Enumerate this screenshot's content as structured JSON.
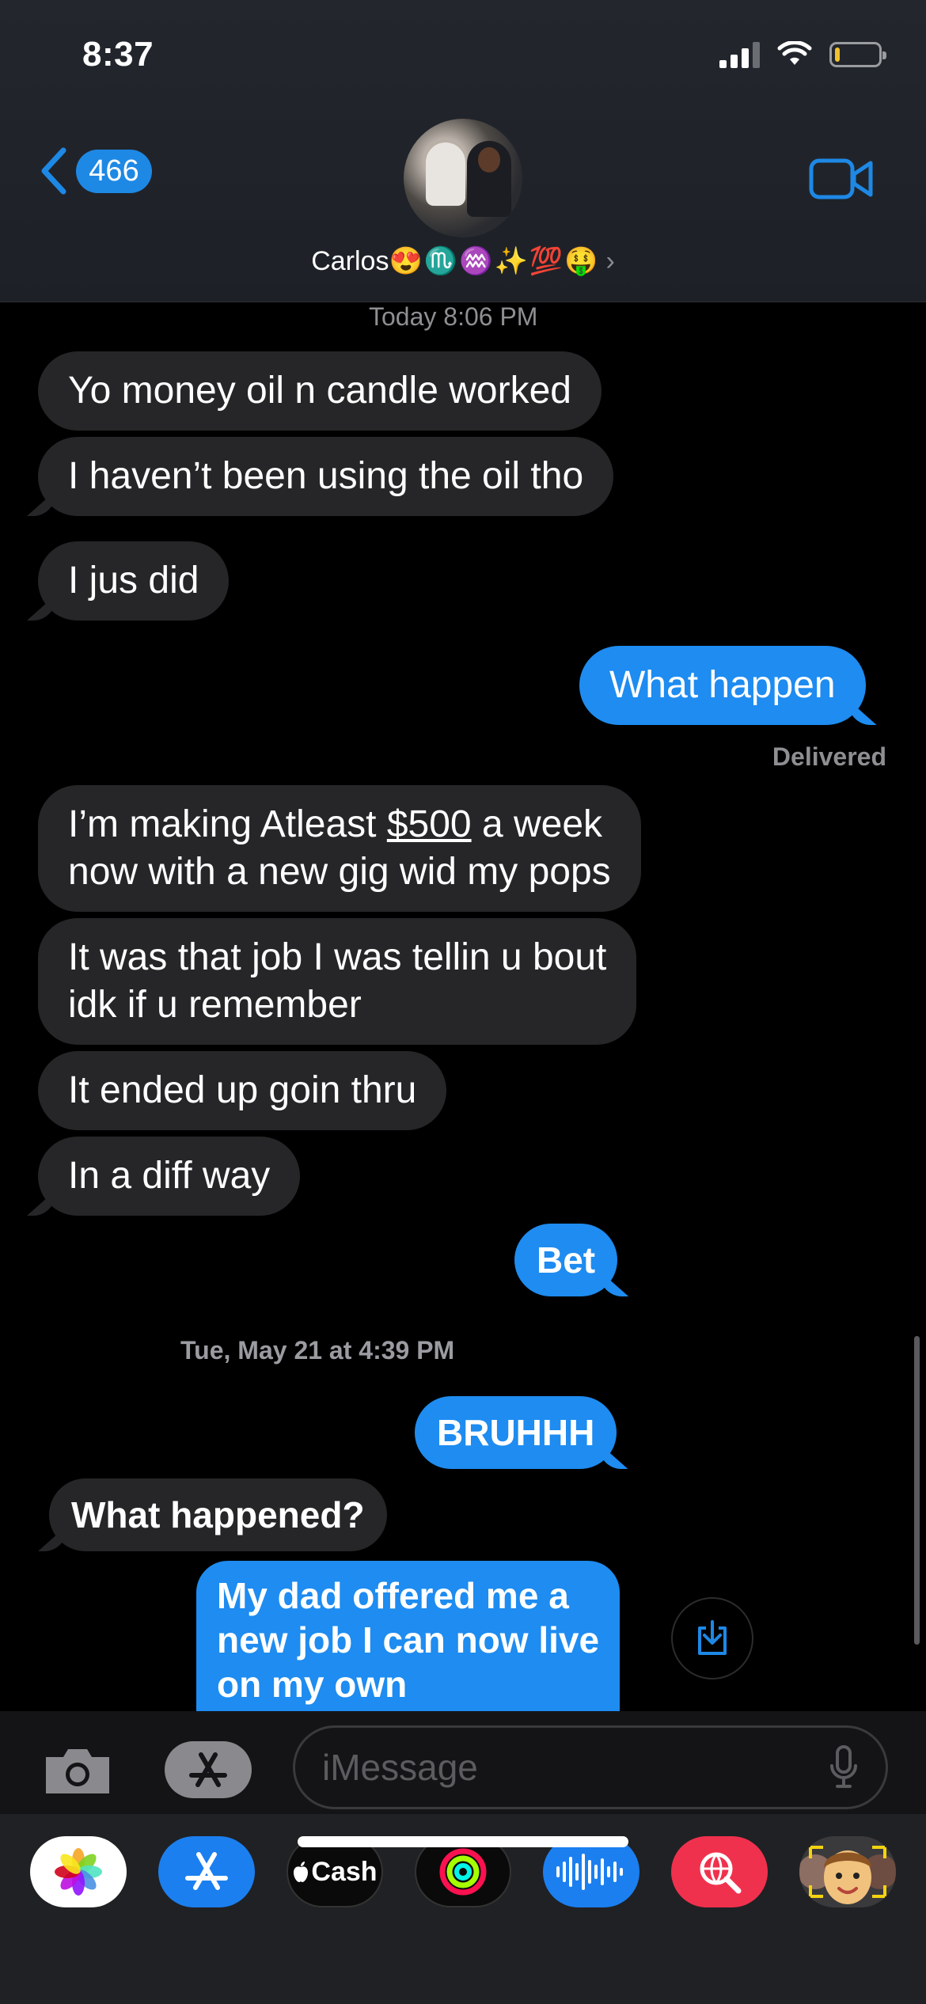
{
  "status_bar": {
    "time": "8:37"
  },
  "header": {
    "back_count": "466",
    "contact_name": "Carlos",
    "contact_emojis": "😍♏♒✨💯🤑",
    "chevron": "›"
  },
  "thread": {
    "stamp_1": "Today 8:06 PM",
    "stamp_2_day": "Tue, May 21",
    "stamp_2_at": " at 4:39 PM",
    "delivered": "Delivered",
    "messages": [
      {
        "dir": "in",
        "text": "Yo money oil n candle worked"
      },
      {
        "dir": "in",
        "text": "I haven’t been using the oil tho"
      },
      {
        "dir": "in",
        "text": "I jus did"
      },
      {
        "dir": "out",
        "text": "What happen"
      },
      {
        "dir": "in",
        "text_pre": "I’m making Atleast ",
        "text_link": "$500",
        "text_post": " a week\nnow with a new gig wid my pops"
      },
      {
        "dir": "in",
        "text": "It was that job I was tellin u bout\nidk if u remember"
      },
      {
        "dir": "in",
        "text": "It ended up goin thru"
      },
      {
        "dir": "in",
        "text": "In a diff way"
      },
      {
        "dir": "out",
        "text": "Bet"
      },
      {
        "dir": "out",
        "text": "BRUHHH"
      },
      {
        "dir": "in",
        "text": "What happened?"
      },
      {
        "dir": "out",
        "text": "My dad offered me a\nnew job I can now live\non my own"
      }
    ]
  },
  "input": {
    "placeholder": "iMessage"
  },
  "apps": {
    "cash_label": "Cash",
    "items": [
      "photos-icon",
      "app-store-icon",
      "apple-cash-icon",
      "activity-icon",
      "audio-message-icon",
      "web-images-icon",
      "memoji-icon"
    ]
  },
  "colors": {
    "outgoing": "#1e8cf0",
    "incoming": "#262628",
    "accent": "#1e88e5"
  }
}
